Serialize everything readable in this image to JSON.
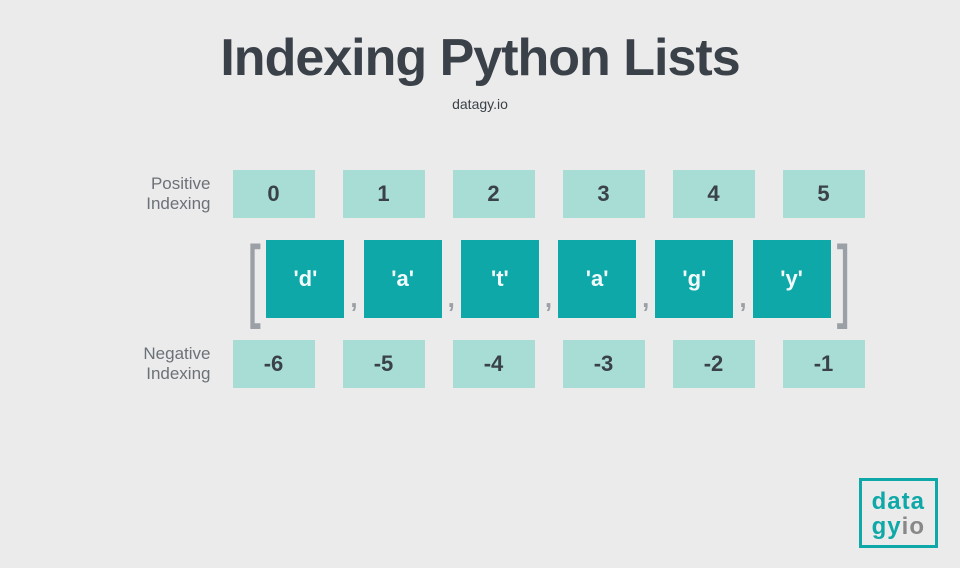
{
  "title": "Indexing Python Lists",
  "subtitle": "datagy.io",
  "labels": {
    "positive": "Positive\nIndexing",
    "negative": "Negative\nIndexing"
  },
  "positive_indices": [
    "0",
    "1",
    "2",
    "3",
    "4",
    "5"
  ],
  "negative_indices": [
    "-6",
    "-5",
    "-4",
    "-3",
    "-2",
    "-1"
  ],
  "list_items": [
    "'d'",
    "'a'",
    "'t'",
    "'a'",
    "'g'",
    "'y'"
  ],
  "brackets": {
    "open": "[",
    "close": "]"
  },
  "comma": ",",
  "logo": {
    "line1": "data",
    "line2a": "gy",
    "line2b": "io"
  }
}
